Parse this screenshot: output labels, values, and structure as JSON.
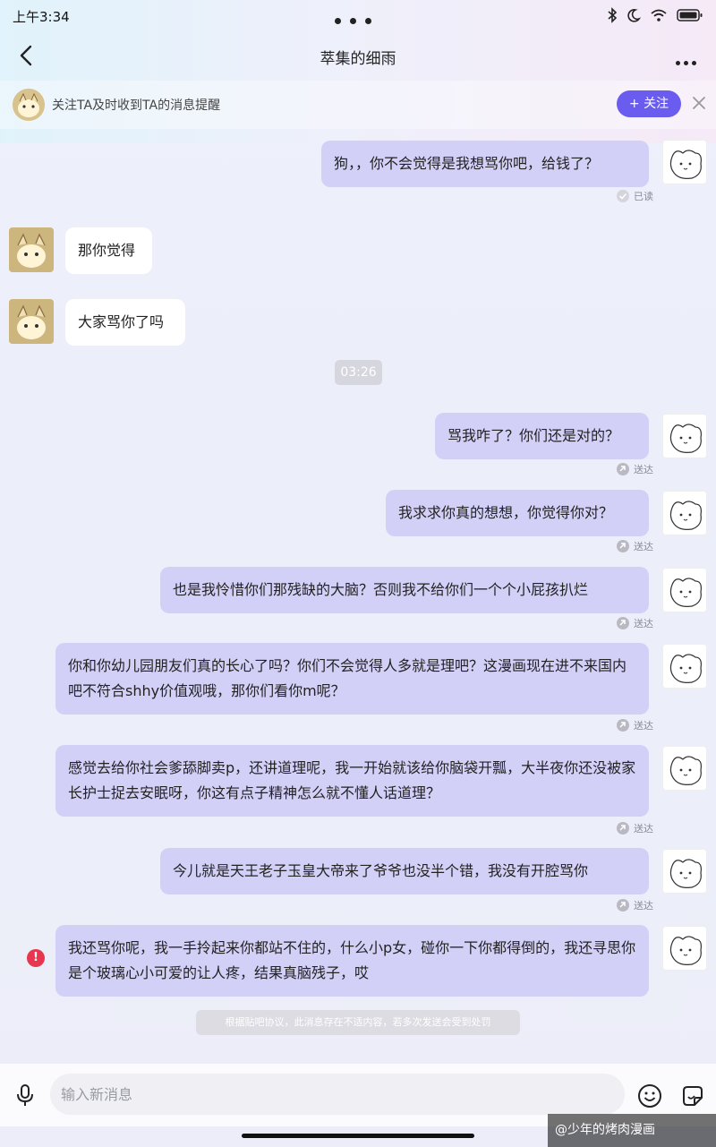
{
  "status_bar": {
    "time": "上午3:34"
  },
  "header": {
    "title": "萃集的细雨"
  },
  "follow_banner": {
    "text": "关注TA及时收到TA的消息提醒",
    "button_label": "+ 关注"
  },
  "messages": [
    {
      "side": "right",
      "text": "狗，，你不会觉得是我想骂你吧，给钱了？",
      "status": "已读"
    },
    {
      "side": "left",
      "text": "那你觉得"
    },
    {
      "side": "left",
      "text": "大家骂你了吗"
    },
    {
      "side": "right",
      "text": "骂我咋了？你们还是对的？",
      "status": "送达"
    },
    {
      "side": "right",
      "text": "我求求你真的想想，你觉得你对？",
      "status": "送达"
    },
    {
      "side": "right",
      "text": "也是我怜惜你们那残缺的大脑？否则我不给你们一个个小屁孩扒烂",
      "status": "送达"
    },
    {
      "side": "right",
      "text": "你和你幼儿园朋友们真的长心了吗？你们不会觉得人多就是理吧？这漫画现在进不来国内吧不符合shhy价值观哦，那你们看你m呢？",
      "status": "送达"
    },
    {
      "side": "right",
      "text": "感觉去给你社会爹舔脚卖p，还讲道理呢，我一开始就该给你脑袋开瓢，大半夜你还没被家长护士捉去安眠呀，你这有点子精神怎么就不懂人话道理？",
      "status": "送达"
    },
    {
      "side": "right",
      "text": "今儿就是天王老子玉皇大帝来了爷爷也没半个错，我没有开腔骂你",
      "status": "送达"
    },
    {
      "side": "right",
      "text": "我还骂你呢，我一手拎起来你都站不住的，什么小p女，碰你一下你都得倒的，我还寻思你是个玻璃心小可爱的让人疼，结果真脑残子，哎",
      "status": ""
    }
  ],
  "time_divider": "03:26",
  "error_mark": "!",
  "notice": "根据贴吧协议，此消息存在不适内容，若多次发送会受到处罚",
  "input": {
    "placeholder": "输入新消息"
  },
  "watermark": "@少年的烤肉漫画",
  "colors": {
    "accent": "#6b5cf0",
    "bubble_right": "#d3d0f8",
    "bubble_left": "#ffffff",
    "error": "#e8364f"
  }
}
